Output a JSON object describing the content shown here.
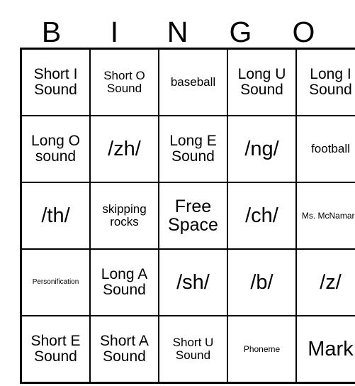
{
  "header": {
    "letters": [
      "B",
      "I",
      "N",
      "G",
      "O"
    ]
  },
  "grid": {
    "rows": [
      [
        {
          "text": "Short I Sound",
          "size": "fs-md"
        },
        {
          "text": "Short O Sound",
          "size": "fs-sm"
        },
        {
          "text": "baseball",
          "size": "fs-sm"
        },
        {
          "text": "Long U Sound",
          "size": "fs-md"
        },
        {
          "text": "Long I Sound",
          "size": "fs-md"
        }
      ],
      [
        {
          "text": "Long O sound",
          "size": "fs-md"
        },
        {
          "text": "/zh/",
          "size": "fs-xl"
        },
        {
          "text": "Long E Sound",
          "size": "fs-md"
        },
        {
          "text": "/ng/",
          "size": "fs-xl"
        },
        {
          "text": "football",
          "size": "fs-sm"
        }
      ],
      [
        {
          "text": "/th/",
          "size": "fs-xl"
        },
        {
          "text": "skipping rocks",
          "size": "fs-sm"
        },
        {
          "text": "Free Space",
          "size": "fs-lg"
        },
        {
          "text": "/ch/",
          "size": "fs-xl"
        },
        {
          "text": "Ms. McNamara",
          "size": "fs-xs"
        }
      ],
      [
        {
          "text": "Personification",
          "size": "fs-xxs"
        },
        {
          "text": "Long A Sound",
          "size": "fs-md"
        },
        {
          "text": "/sh/",
          "size": "fs-xl"
        },
        {
          "text": "/b/",
          "size": "fs-xl"
        },
        {
          "text": "/z/",
          "size": "fs-xl"
        }
      ],
      [
        {
          "text": "Short E Sound",
          "size": "fs-md"
        },
        {
          "text": "Short A Sound",
          "size": "fs-md"
        },
        {
          "text": "Short U Sound",
          "size": "fs-sm"
        },
        {
          "text": "Phoneme",
          "size": "fs-xs"
        },
        {
          "text": "Mark",
          "size": "fs-xl"
        }
      ]
    ]
  }
}
